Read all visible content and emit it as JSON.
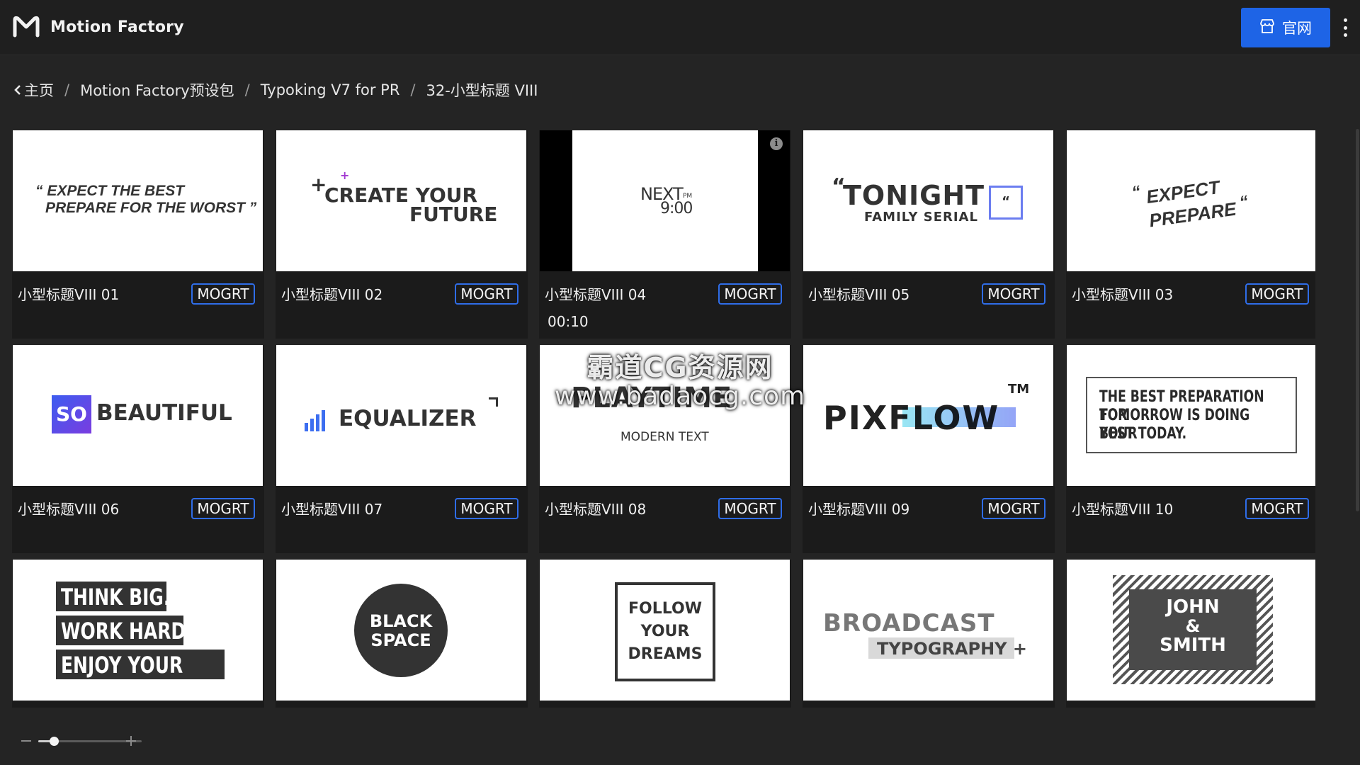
{
  "app": {
    "name": "Motion Factory"
  },
  "header": {
    "site_button_label": "官网",
    "site_button_icon": "storefront-icon",
    "menu_icon": "more-vertical-icon",
    "accent": "#1e64e6"
  },
  "breadcrumb": [
    {
      "label": "主页",
      "icon": "chevron-left-icon"
    },
    {
      "label": "Motion Factory预设包"
    },
    {
      "label": "Typoking V7 for PR"
    },
    {
      "label": "32-小型标题 VIII"
    }
  ],
  "cards": [
    {
      "title": "小型标题VIII 01",
      "badge": "MOGRT",
      "preview": [
        "“ EXPECT THE BEST",
        "PREPARE FOR THE WORST ”"
      ]
    },
    {
      "title": "小型标题VIII 02",
      "badge": "MOGRT",
      "preview": [
        "CREATE YOUR",
        "FUTURE"
      ]
    },
    {
      "title": "小型标题VIII 04",
      "badge": "MOGRT",
      "duration": "00:10",
      "preview": [
        "NEXT",
        "PM",
        "9:00"
      ]
    },
    {
      "title": "小型标题VIII 05",
      "badge": "MOGRT",
      "preview": [
        "TONIGHT",
        "FAMILY SERIAL"
      ]
    },
    {
      "title": "小型标题VIII 03",
      "badge": "MOGRT",
      "preview": [
        "EXPECT",
        "PREPARE"
      ]
    },
    {
      "title": "小型标题VIII 06",
      "badge": "MOGRT",
      "preview": [
        "SO",
        "BEAUTIFUL"
      ]
    },
    {
      "title": "小型标题VIII 07",
      "badge": "MOGRT",
      "preview": [
        "EQUALIZER"
      ]
    },
    {
      "title": "小型标题VIII 08",
      "badge": "MOGRT",
      "preview": [
        "PLAYTIME",
        "MODERN TEXT"
      ]
    },
    {
      "title": "小型标题VIII 09",
      "badge": "MOGRT",
      "preview": [
        "PIXFLOW",
        "TM"
      ]
    },
    {
      "title": "小型标题VIII 10",
      "badge": "MOGRT",
      "preview": [
        "THE BEST PREPARATION FOR",
        "TOMORROW IS DOING YOUR",
        "BEST TODAY."
      ]
    },
    {
      "preview": [
        "THINK BIG.",
        "WORK HARD.",
        "ENJOY YOUR LIFE."
      ]
    },
    {
      "preview": [
        "BLACK",
        "SPACE"
      ]
    },
    {
      "preview": [
        "FOLLOW",
        "YOUR",
        "DREAMS"
      ]
    },
    {
      "preview": [
        "BROADCAST",
        "TYPOGRAPHY +"
      ]
    },
    {
      "preview": [
        "JOHN",
        "&",
        "SMITH"
      ]
    }
  ],
  "zoom": {
    "level": 0.15
  },
  "watermark": {
    "line1": "霸道CG资源网",
    "line2": "www.badaocg.com"
  }
}
